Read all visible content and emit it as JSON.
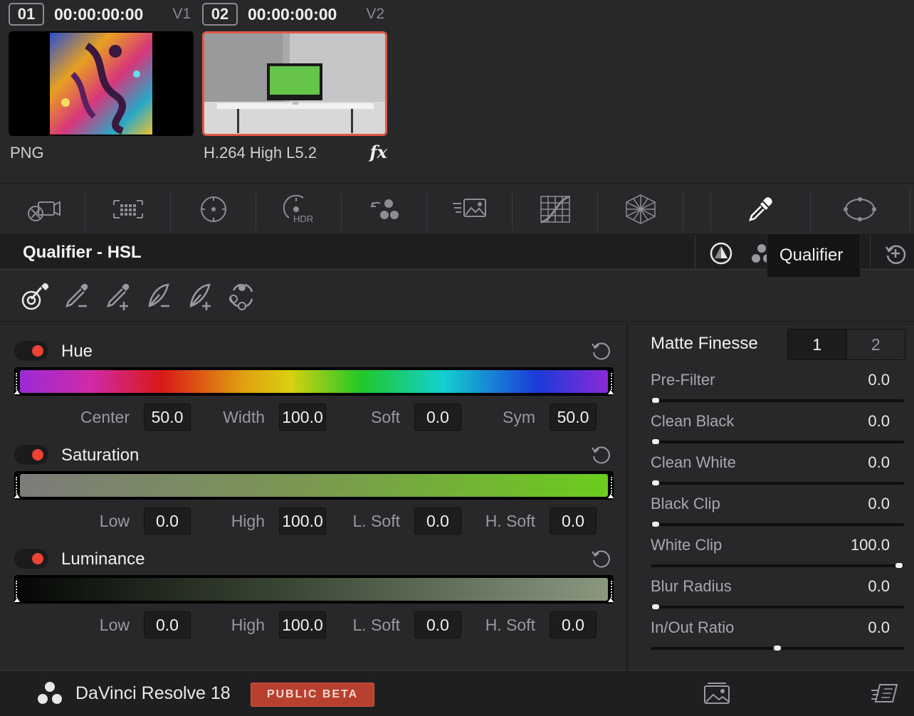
{
  "clips": [
    {
      "number": "01",
      "timecode": "00:00:00:00",
      "track": "V1",
      "codec": "PNG",
      "fx": ""
    },
    {
      "number": "02",
      "timecode": "00:00:00:00",
      "track": "V2",
      "codec": "H.264 High L5.2",
      "fx": "fx"
    }
  ],
  "palette_toolbar": {
    "icons": [
      "camera-raw-icon",
      "color-match-icon",
      "color-wheels-icon",
      "hdr-icon",
      "rgb-mixer-icon",
      "motion-effects-icon",
      "curves-icon",
      "color-warper-icon",
      "qualifier-icon",
      "window-icon"
    ],
    "hdr_label": "HDR"
  },
  "qualifier": {
    "title": "Qualifier - HSL",
    "tooltip": "Qualifier"
  },
  "hue": {
    "label": "Hue",
    "params": [
      {
        "label": "Center",
        "value": "50.0"
      },
      {
        "label": "Width",
        "value": "100.0"
      },
      {
        "label": "Soft",
        "value": "0.0"
      },
      {
        "label": "Sym",
        "value": "50.0"
      }
    ]
  },
  "saturation": {
    "label": "Saturation",
    "params": [
      {
        "label": "Low",
        "value": "0.0"
      },
      {
        "label": "High",
        "value": "100.0"
      },
      {
        "label": "L. Soft",
        "value": "0.0"
      },
      {
        "label": "H. Soft",
        "value": "0.0"
      }
    ]
  },
  "luminance": {
    "label": "Luminance",
    "params": [
      {
        "label": "Low",
        "value": "0.0"
      },
      {
        "label": "High",
        "value": "100.0"
      },
      {
        "label": "L. Soft",
        "value": "0.0"
      },
      {
        "label": "H. Soft",
        "value": "0.0"
      }
    ]
  },
  "matte_finesse": {
    "title": "Matte Finesse",
    "tabs": [
      "1",
      "2"
    ],
    "selected_tab": "1",
    "rows": [
      {
        "label": "Pre-Filter",
        "value": "0.0",
        "level": 0
      },
      {
        "label": "Clean Black",
        "value": "0.0",
        "level": 0
      },
      {
        "label": "Clean White",
        "value": "0.0",
        "level": 0
      },
      {
        "label": "Black Clip",
        "value": "0.0",
        "level": 0
      },
      {
        "label": "White Clip",
        "value": "100.0",
        "level": 1
      },
      {
        "label": "Blur Radius",
        "value": "0.0",
        "level": 0
      },
      {
        "label": "In/Out Ratio",
        "value": "0.0",
        "level": 0.5
      }
    ]
  },
  "footer": {
    "app_name": "DaVinci Resolve 18",
    "badge": "PUBLIC BETA"
  },
  "colors": {
    "accent_red": "#ec4234",
    "selection_border": "#e05a46",
    "badge": "#b8402f"
  }
}
